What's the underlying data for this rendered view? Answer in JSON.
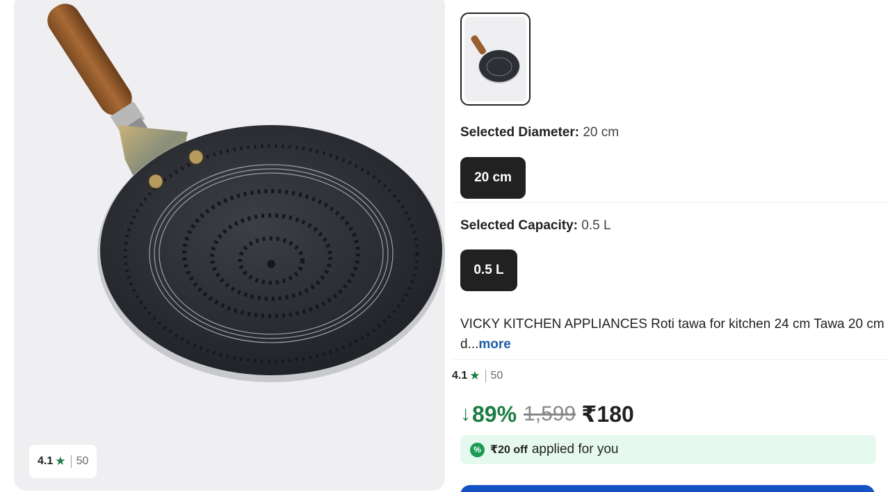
{
  "product_image": {
    "alt": ""
  },
  "image_rating": {
    "value": "4.1",
    "star_icon": "star-icon",
    "count": "50"
  },
  "thumbnails": [
    {
      "selected": true
    }
  ],
  "diameter": {
    "label": "Selected Diameter:",
    "value": "20 cm",
    "options": [
      "20 cm"
    ]
  },
  "capacity": {
    "label": "Selected Capacity:",
    "value": "0.5 L",
    "options": [
      "0.5 L"
    ]
  },
  "title": {
    "text": "VICKY KITCHEN APPLIANCES Roti tawa for kitchen 24 cm Tawa 20 cm d...",
    "more": "more"
  },
  "rating": {
    "value": "4.1",
    "count": "50"
  },
  "pricing": {
    "arrow": "↓",
    "discount": "89%",
    "mrp": "1,599",
    "price": "₹180"
  },
  "offer": {
    "badge": "%",
    "amount": "₹20 off",
    "text": "applied for you"
  },
  "colors": {
    "accent_green": "#1b7c42",
    "cta_blue": "#1452c6",
    "offer_bg": "#e6f9ef",
    "chip_dark": "#212121"
  }
}
